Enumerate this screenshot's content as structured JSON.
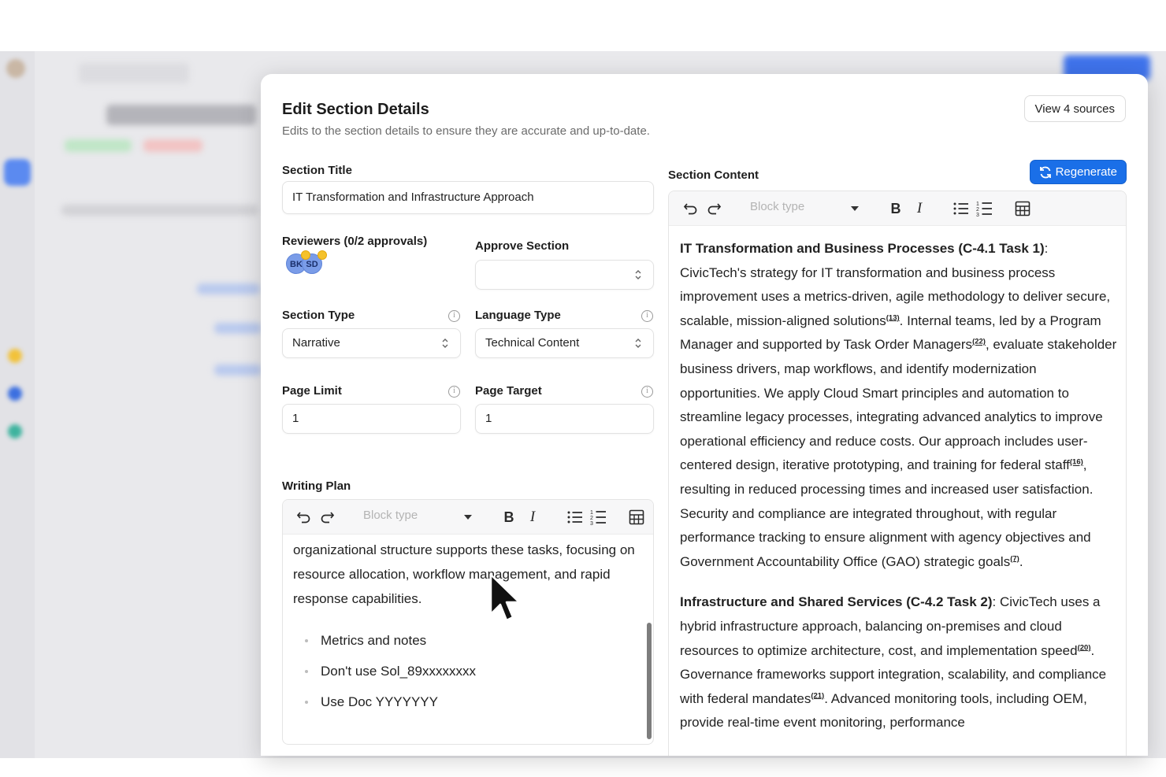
{
  "modal": {
    "title": "Edit Section Details",
    "subtitle": "Edits to the section details to ensure they are accurate and up-to-date.",
    "view_sources_label": "View 4 sources"
  },
  "form": {
    "section_title_label": "Section Title",
    "section_title_value": "IT Transformation and Infrastructure Approach",
    "reviewers_label": "Reviewers (0/2 approvals)",
    "reviewers": [
      "BK",
      "SD"
    ],
    "approve_section_label": "Approve Section",
    "approve_section_value": "",
    "section_type_label": "Section Type",
    "section_type_value": "Narrative",
    "language_type_label": "Language Type",
    "language_type_value": "Technical Content",
    "page_limit_label": "Page Limit",
    "page_limit_value": "1",
    "page_target_label": "Page Target",
    "page_target_value": "1",
    "writing_plan_label": "Writing Plan"
  },
  "editor_toolbar": {
    "block_type_placeholder": "Block type",
    "bold": "B",
    "italic": "I"
  },
  "writing_plan": {
    "text": "organizational structure supports these tasks, focusing on resource allocation, workflow management, and rapid response capabilities.",
    "bullets": [
      "Metrics and notes",
      "Don't use Sol_89xxxxxxxx",
      "Use Doc YYYYYYY"
    ]
  },
  "section_content": {
    "label": "Section Content",
    "regenerate_label": "Regenerate",
    "p1_heading": "IT Transformation and Business Processes (C-4.1 Task 1)",
    "p1_a": ": CivicTech's strategy for IT transformation and business process improvement uses a metrics-driven, agile methodology to deliver secure, scalable, mission-aligned solutions",
    "p1_c1": "(13)",
    "p1_b": ". Internal teams, led by a Program Manager and supported by Task Order Managers",
    "p1_c2": "(22)",
    "p1_c": ", evaluate stakeholder business drivers, map workflows, and identify modernization opportunities. We apply Cloud Smart principles and automation to streamline legacy processes, integrating advanced analytics to improve operational efficiency and reduce costs. Our approach includes user-centered design, iterative prototyping, and training for federal staff",
    "p1_c3": "(16)",
    "p1_d": ", resulting in reduced processing times and increased user satisfaction. Security and compliance are integrated throughout, with regular performance tracking to ensure alignment with agency objectives and Government Accountability Office (GAO) strategic goals",
    "p1_c4": "(7)",
    "p1_e": ".",
    "p2_heading": "Infrastructure and Shared Services (C-4.2 Task 2)",
    "p2_a": ": CivicTech uses a hybrid infrastructure approach, balancing on-premises and cloud resources to optimize architecture, cost, and implementation speed",
    "p2_c1": "(20)",
    "p2_b": ". Governance frameworks support integration, scalability, and compliance with federal mandates",
    "p2_c2": "(21)",
    "p2_c": ". Advanced monitoring tools, including OEM, provide real-time event monitoring, performance"
  },
  "icons": [
    "undo-icon",
    "redo-icon",
    "bulleted-list-icon",
    "numbered-list-icon",
    "table-icon",
    "info-icon",
    "chevron-updown-icon",
    "refresh-icon",
    "mouse-cursor-icon"
  ]
}
